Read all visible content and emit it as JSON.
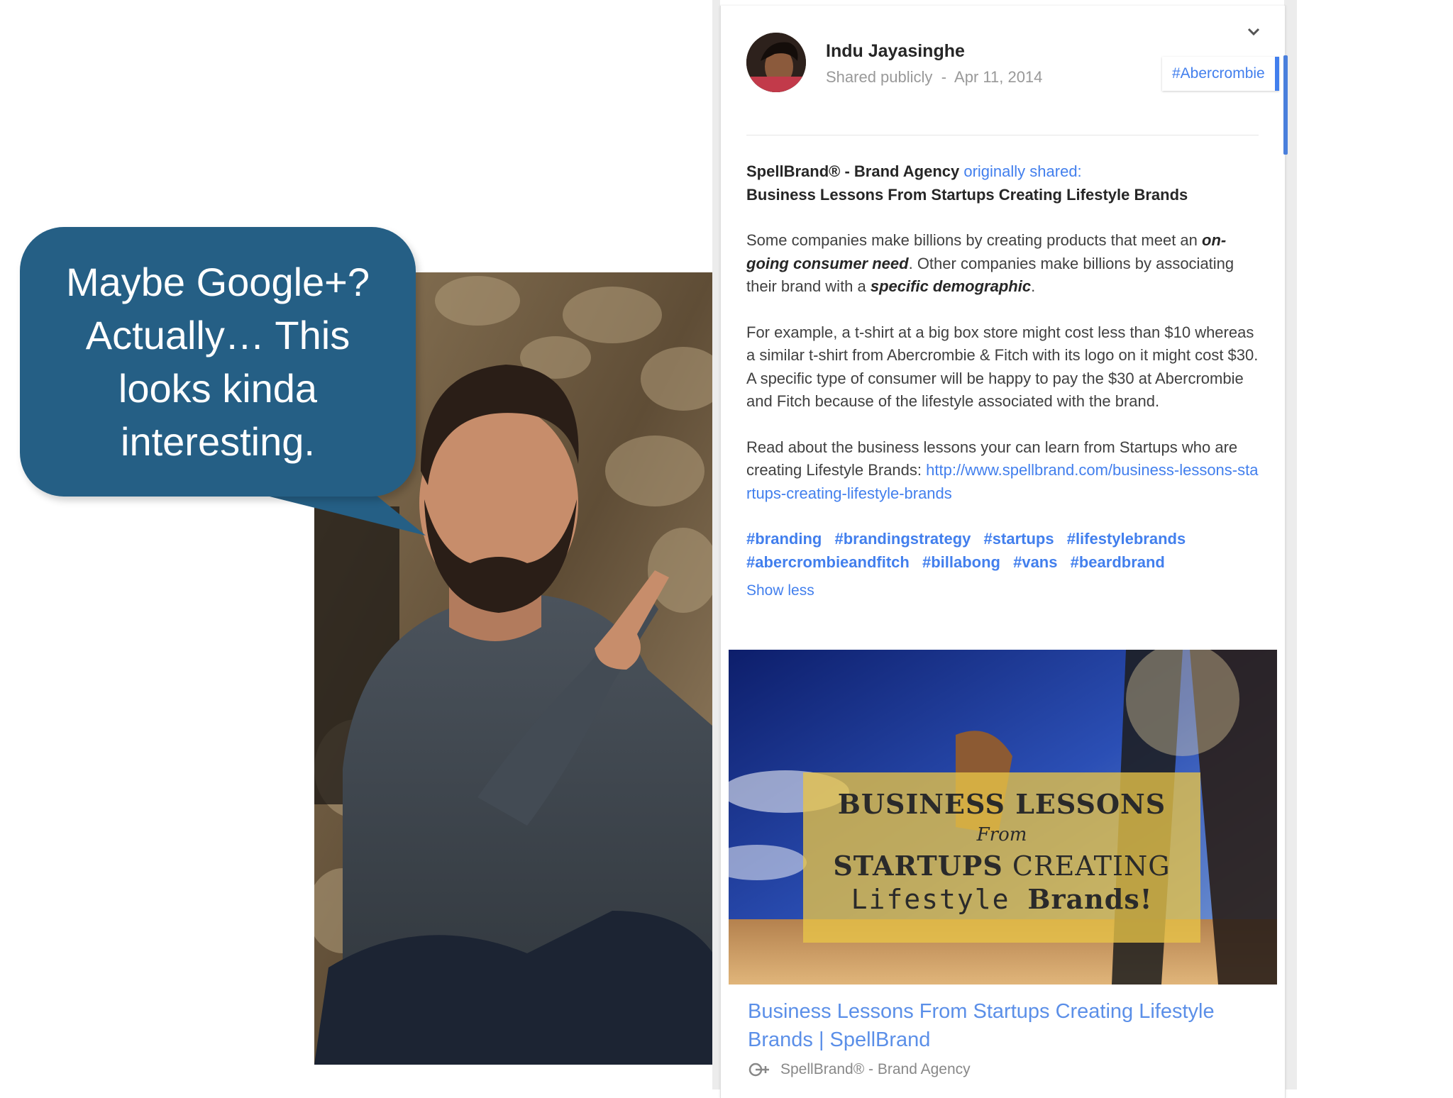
{
  "speech_bubble": {
    "lines": [
      "Maybe Google+?",
      "Actually… This",
      "looks kinda",
      "interesting."
    ]
  },
  "post": {
    "author": "Indu Jayasinghe",
    "visibility": "Shared publicly",
    "separator": "-",
    "date": "Apr 11, 2014",
    "tag_chip": "#Abercrombie",
    "reshare": {
      "source": "SpellBrand® - Brand Agency",
      "action": "originally shared:"
    },
    "headline": "Business Lessons From Startups Creating Lifestyle Brands",
    "paragraph1": {
      "a": "Some companies make billions by creating products that meet an ",
      "b": "on-going consumer need",
      "c": ". Other companies make billions by associating their brand with a ",
      "d": "specific demographic",
      "e": "."
    },
    "paragraph2": "For example, a t-shirt at a big box store might cost less than $10 whereas a similar t-shirt from Abercrombie & Fitch with its logo on it might cost $30. A specific type of consumer will be happy to pay the $30 at Abercrombie and Fitch because of the lifestyle associated with the brand.",
    "paragraph3": {
      "text": "Read about the business lessons your can learn from Startups who are creating Lifestyle Brands: ",
      "url": "http://www.spellbrand.com/business-lessons-startups-creating-lifestyle-brands"
    },
    "hashtags": [
      "#branding",
      "#brandingstrategy",
      "#startups",
      "#lifestylebrands",
      "#abercrombieandfitch",
      "#billabong",
      "#vans",
      "#beardbrand"
    ],
    "show_less": "Show less",
    "preview_image_text": {
      "line1": "BUSINESS LESSONS",
      "line2": "From",
      "line3_bold": "STARTUPS",
      "line3_rest": " CREATING",
      "line4_a": "Lifestyle ",
      "line4_b": "Brands!"
    },
    "link_title": "Business Lessons From Startups Creating Lifestyle Brands | SpellBrand",
    "link_source": "SpellBrand® - Brand Agency"
  },
  "icons": {
    "chevron": "chevron-down-icon",
    "google_plus": "google-plus-page-icon",
    "avatar": "author-avatar"
  },
  "colors": {
    "bubble": "#255f85",
    "link": "#427fed",
    "overlay": "#e8c448"
  }
}
